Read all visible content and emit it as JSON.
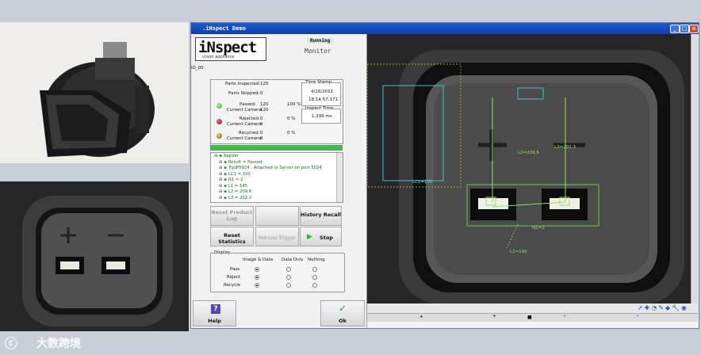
{
  "window": {
    "title": ".iNspect Demo"
  },
  "brand": {
    "logo": "iNspect",
    "tagline": "vision appliance",
    "status": "Running",
    "mode": "Monitor"
  },
  "camera_id": "ID_00",
  "stats": {
    "parts_inspected_label": "Parts Inspected:",
    "parts_inspected": "120",
    "parts_skipped_label": "Parts Skipped:",
    "parts_skipped": "0",
    "passed_label": "Passed:",
    "passed": "120",
    "passed_pct": "100 %",
    "current_camera_label": "Current Camera",
    "passed_cur": "120",
    "rejected_label": "Rejected:",
    "rejected": "0",
    "rejected_pct": "0 %",
    "rejected_cur": "0",
    "recycled_label": "Recycled:",
    "recycled": "0",
    "recycled_pct": "0 %",
    "recycled_cur": "0"
  },
  "timestamp": {
    "label": "Time Stamp",
    "date": "4/16/2011",
    "time": "18:14:57.171"
  },
  "inspect_time": {
    "label": "Inspect Time",
    "value": "1.299 ms"
  },
  "tree": [
    "AppVar",
    "Result = Passed",
    "TcpIP5024 : Attached to Server on port 5024",
    "LC1 = 100",
    "N1 = 2",
    "L1 = 145",
    "L2 = 209.6",
    "L3 = 202.3"
  ],
  "buttons": {
    "reset_product": "Reset Product Log",
    "history_recall": "History Recall",
    "reset_statistics": "Reset Statistics",
    "manual_trigger": "Manual Trigger",
    "stop": "Stop",
    "help": "Help",
    "ok": "Ok"
  },
  "display": {
    "title": "Display",
    "columns": [
      "Image & Data",
      "Data Only",
      "Nothing"
    ],
    "rows": [
      {
        "label": "Pass",
        "selected": 0
      },
      {
        "label": "Reject",
        "selected": 0
      },
      {
        "label": "Recycle",
        "selected": 0
      }
    ]
  },
  "overlay": {
    "lc1": "LC1=100",
    "l2": "L2=209.6",
    "l3": "L3=202.3",
    "n1": "N1=2",
    "l1": "L1=145"
  },
  "bottom_scale": {
    "marks": [
      "+",
      "+",
      "■",
      "-",
      "-"
    ]
  },
  "watermark": {
    "text": "大数跨境"
  }
}
